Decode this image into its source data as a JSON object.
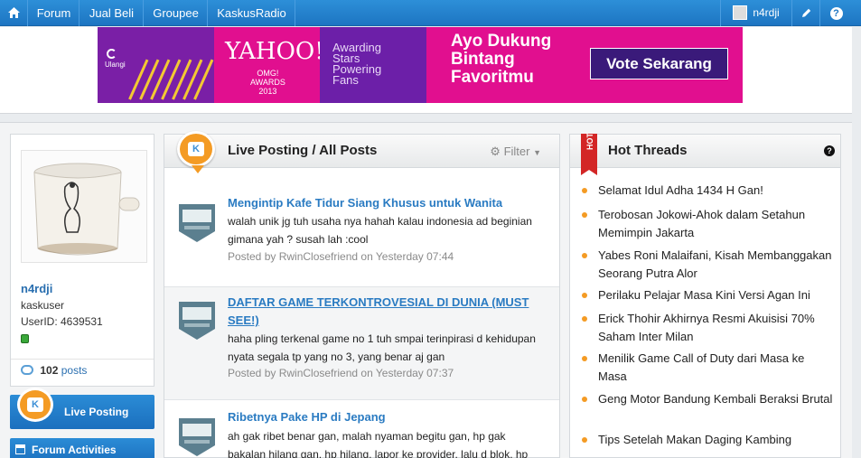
{
  "topnav": {
    "items": [
      "Forum",
      "Jual Beli",
      "Groupee",
      "KaskusRadio"
    ],
    "username": "n4rdji",
    "help": "?"
  },
  "banner": {
    "ulangi": "Ulangi",
    "yahoo": "YAHOO!",
    "omg_lines": [
      "OMG!",
      "AWARDS",
      "2013"
    ],
    "awarding_lines": [
      "Awarding",
      "Stars",
      "Powering",
      "Fans"
    ],
    "headline_lines": [
      "Ayo Dukung",
      "Bintang",
      "Favoritmu"
    ],
    "cta": "Vote Sekarang"
  },
  "profile": {
    "username": "n4rdji",
    "title": "kaskuser",
    "userid": "UserID: 4639531",
    "post_count": "102",
    "posts_label": "posts"
  },
  "sidebar": {
    "live_posting": "Live Posting",
    "forum_activities": "Forum Activities"
  },
  "live": {
    "title": "Live Posting / All Posts",
    "filter": "Filter",
    "posts": [
      {
        "title": "Mengintip Kafe Tidur Siang Khusus untuk Wanita",
        "text": "walah unik jg tuh usaha nya hahah kalau indonesia ad beginian gimana yah ? susah lah :cool",
        "meta": "Posted by RwinClosefriend on Yesterday 07:44"
      },
      {
        "title": "DAFTAR GAME TERKONTROVESIAL DI DUNIA (MUST SEE!)",
        "text": "haha pling terkenal game no 1 tuh smpai terinpirasi d kehidupan nyata segala tp yang no 3, yang benar aj gan",
        "meta": "Posted by RwinClosefriend on Yesterday 07:37"
      },
      {
        "title": "Ribetnya Pake HP di Jepang",
        "text": "ah gak ribet benar gan, malah nyaman begitu gan, hp gak bakalan hilang gan, hp hilang, lapor ke provider, lalu d blok, hp",
        "meta": ""
      }
    ]
  },
  "hot": {
    "ribbon": "HOT",
    "title": "Hot Threads",
    "items": [
      "Selamat Idul Adha 1434 H Gan!",
      "Terobosan Jokowi-Ahok dalam Setahun Memimpin Jakarta",
      "Yabes Roni Malaifani, Kisah Membanggakan Seorang Putra Alor",
      "Perilaku Pelajar Masa Kini Versi Agan Ini",
      "Erick Thohir Akhirnya Resmi Akuisisi 70% Saham Inter Milan",
      "Menilik Game Call of Duty dari Masa ke Masa",
      "Geng Motor Bandung Kembali Beraksi Brutal",
      "Tips Setelah Makan Daging Kambing"
    ]
  }
}
